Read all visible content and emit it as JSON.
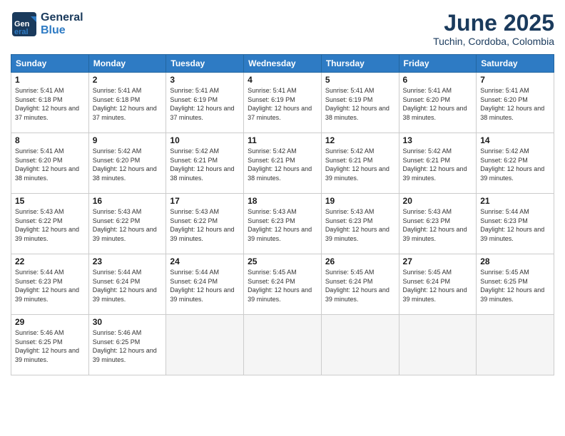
{
  "header": {
    "logo_line1": "General",
    "logo_line2": "Blue",
    "month": "June 2025",
    "location": "Tuchin, Cordoba, Colombia"
  },
  "days_of_week": [
    "Sunday",
    "Monday",
    "Tuesday",
    "Wednesday",
    "Thursday",
    "Friday",
    "Saturday"
  ],
  "weeks": [
    [
      {
        "day": "1",
        "sunrise": "5:41 AM",
        "sunset": "6:18 PM",
        "daylight": "12 hours and 37 minutes"
      },
      {
        "day": "2",
        "sunrise": "5:41 AM",
        "sunset": "6:18 PM",
        "daylight": "12 hours and 37 minutes"
      },
      {
        "day": "3",
        "sunrise": "5:41 AM",
        "sunset": "6:19 PM",
        "daylight": "12 hours and 37 minutes"
      },
      {
        "day": "4",
        "sunrise": "5:41 AM",
        "sunset": "6:19 PM",
        "daylight": "12 hours and 37 minutes"
      },
      {
        "day": "5",
        "sunrise": "5:41 AM",
        "sunset": "6:19 PM",
        "daylight": "12 hours and 38 minutes"
      },
      {
        "day": "6",
        "sunrise": "5:41 AM",
        "sunset": "6:20 PM",
        "daylight": "12 hours and 38 minutes"
      },
      {
        "day": "7",
        "sunrise": "5:41 AM",
        "sunset": "6:20 PM",
        "daylight": "12 hours and 38 minutes"
      }
    ],
    [
      {
        "day": "8",
        "sunrise": "5:41 AM",
        "sunset": "6:20 PM",
        "daylight": "12 hours and 38 minutes"
      },
      {
        "day": "9",
        "sunrise": "5:42 AM",
        "sunset": "6:20 PM",
        "daylight": "12 hours and 38 minutes"
      },
      {
        "day": "10",
        "sunrise": "5:42 AM",
        "sunset": "6:21 PM",
        "daylight": "12 hours and 38 minutes"
      },
      {
        "day": "11",
        "sunrise": "5:42 AM",
        "sunset": "6:21 PM",
        "daylight": "12 hours and 38 minutes"
      },
      {
        "day": "12",
        "sunrise": "5:42 AM",
        "sunset": "6:21 PM",
        "daylight": "12 hours and 39 minutes"
      },
      {
        "day": "13",
        "sunrise": "5:42 AM",
        "sunset": "6:21 PM",
        "daylight": "12 hours and 39 minutes"
      },
      {
        "day": "14",
        "sunrise": "5:42 AM",
        "sunset": "6:22 PM",
        "daylight": "12 hours and 39 minutes"
      }
    ],
    [
      {
        "day": "15",
        "sunrise": "5:43 AM",
        "sunset": "6:22 PM",
        "daylight": "12 hours and 39 minutes"
      },
      {
        "day": "16",
        "sunrise": "5:43 AM",
        "sunset": "6:22 PM",
        "daylight": "12 hours and 39 minutes"
      },
      {
        "day": "17",
        "sunrise": "5:43 AM",
        "sunset": "6:22 PM",
        "daylight": "12 hours and 39 minutes"
      },
      {
        "day": "18",
        "sunrise": "5:43 AM",
        "sunset": "6:23 PM",
        "daylight": "12 hours and 39 minutes"
      },
      {
        "day": "19",
        "sunrise": "5:43 AM",
        "sunset": "6:23 PM",
        "daylight": "12 hours and 39 minutes"
      },
      {
        "day": "20",
        "sunrise": "5:43 AM",
        "sunset": "6:23 PM",
        "daylight": "12 hours and 39 minutes"
      },
      {
        "day": "21",
        "sunrise": "5:44 AM",
        "sunset": "6:23 PM",
        "daylight": "12 hours and 39 minutes"
      }
    ],
    [
      {
        "day": "22",
        "sunrise": "5:44 AM",
        "sunset": "6:23 PM",
        "daylight": "12 hours and 39 minutes"
      },
      {
        "day": "23",
        "sunrise": "5:44 AM",
        "sunset": "6:24 PM",
        "daylight": "12 hours and 39 minutes"
      },
      {
        "day": "24",
        "sunrise": "5:44 AM",
        "sunset": "6:24 PM",
        "daylight": "12 hours and 39 minutes"
      },
      {
        "day": "25",
        "sunrise": "5:45 AM",
        "sunset": "6:24 PM",
        "daylight": "12 hours and 39 minutes"
      },
      {
        "day": "26",
        "sunrise": "5:45 AM",
        "sunset": "6:24 PM",
        "daylight": "12 hours and 39 minutes"
      },
      {
        "day": "27",
        "sunrise": "5:45 AM",
        "sunset": "6:24 PM",
        "daylight": "12 hours and 39 minutes"
      },
      {
        "day": "28",
        "sunrise": "5:45 AM",
        "sunset": "6:25 PM",
        "daylight": "12 hours and 39 minutes"
      }
    ],
    [
      {
        "day": "29",
        "sunrise": "5:46 AM",
        "sunset": "6:25 PM",
        "daylight": "12 hours and 39 minutes"
      },
      {
        "day": "30",
        "sunrise": "5:46 AM",
        "sunset": "6:25 PM",
        "daylight": "12 hours and 39 minutes"
      },
      null,
      null,
      null,
      null,
      null
    ]
  ]
}
